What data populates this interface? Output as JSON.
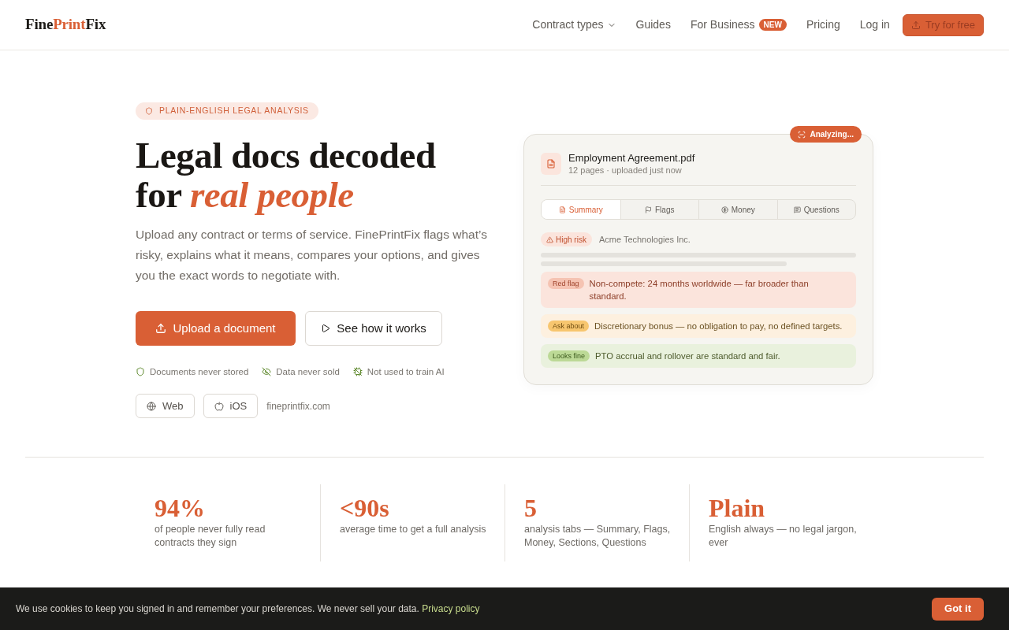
{
  "header": {
    "logo": [
      {
        "text": "Fine",
        "accent": false
      },
      {
        "text": "Print",
        "accent": true
      },
      {
        "text": "Fix",
        "accent": false
      }
    ],
    "nav": [
      {
        "label": "Contract types",
        "kind": "dropdown"
      },
      {
        "label": "Guides",
        "kind": "link"
      },
      {
        "label": "For Business",
        "kind": "link",
        "badge": "NEW"
      },
      {
        "label": "Pricing",
        "kind": "link"
      },
      {
        "label": "Log in",
        "kind": "link"
      }
    ],
    "cta": "Try for free"
  },
  "hero": {
    "eyebrow": "PLAIN-ENGLISH LEGAL ANALYSIS",
    "headline": [
      "Legal docs decoded",
      "for *real people*"
    ],
    "description": "Upload any contract or terms of service. FinePrintFix flags what’s risky, explains what it means, compares your options, and gives you the exact words to negotiate with.",
    "actions": [
      {
        "label": "Upload a document",
        "kind": "primary"
      },
      {
        "label": "See how it works",
        "kind": "secondary"
      }
    ],
    "assurances": [
      {
        "label": "Documents never stored",
        "kind": "stored"
      },
      {
        "label": "Data never sold",
        "kind": "sold"
      },
      {
        "label": "Not used to train AI",
        "kind": "ai"
      }
    ],
    "platforms": [
      {
        "label": "Web",
        "kind": "web"
      },
      {
        "label": "iOS",
        "kind": "ios"
      }
    ],
    "domain": "fineprintfix.com"
  },
  "preview": {
    "status": "Analyzing...",
    "file": {
      "name": "Employment Agreement.pdf",
      "meta": "12 pages · uploaded just now"
    },
    "tabs": [
      {
        "label": "Summary",
        "kind": "summary",
        "selected": true
      },
      {
        "label": "Flags",
        "kind": "flags",
        "selected": false
      },
      {
        "label": "Money",
        "kind": "money",
        "selected": false
      },
      {
        "label": "Questions",
        "kind": "questions",
        "selected": false
      }
    ],
    "risk": {
      "label": "High risk",
      "company": "Acme Technologies Inc."
    },
    "findings": [
      {
        "tag": "Red flag",
        "text": "Non-compete: 24 months worldwide — far broader than standard.",
        "kind": "danger"
      },
      {
        "tag": "Ask about",
        "text": "Discretionary bonus — no obligation to pay, no defined targets.",
        "kind": "warning"
      },
      {
        "tag": "Looks fine",
        "text": "PTO accrual and rollover are standard and fair.",
        "kind": "ok"
      }
    ]
  },
  "stats": [
    {
      "value": "94%",
      "caption": "of people never fully read contracts they sign"
    },
    {
      "value": "<90s",
      "caption": "average time to get a full analysis"
    },
    {
      "value": "5",
      "caption": "analysis tabs — Summary, Flags, Money, Sections, Questions"
    },
    {
      "value": "Plain",
      "caption": "English always — no legal jargon, ever"
    }
  ],
  "cookie_banner": {
    "text": "We use cookies to keep you signed in and remember your preferences. We never sell your data.",
    "link": "Privacy policy",
    "button": "Got it"
  }
}
